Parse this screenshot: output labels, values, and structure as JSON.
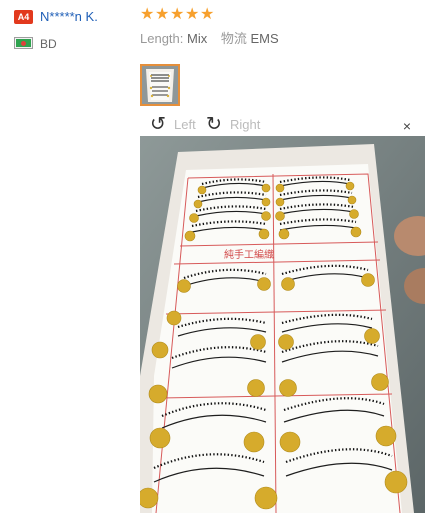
{
  "reviewer": {
    "badge": "A4",
    "name": "N*****n K.",
    "country": "BD"
  },
  "rating": {
    "stars": 5,
    "max": 5
  },
  "attributes": {
    "length_label": "Length:",
    "length_value": "Mix",
    "shipping_label": "物流",
    "shipping_value": "EMS"
  },
  "viewer": {
    "rotate_left_label": "Left",
    "rotate_right_label": "Right",
    "close_symbol": "×"
  },
  "product_text": "純手工編織",
  "colors": {
    "username": "#1f5fb7",
    "badge_bg": "#e2391d",
    "star": "#f7a02d",
    "thumb_border": "#e58f3b",
    "photo_bg": "#7c8788"
  }
}
